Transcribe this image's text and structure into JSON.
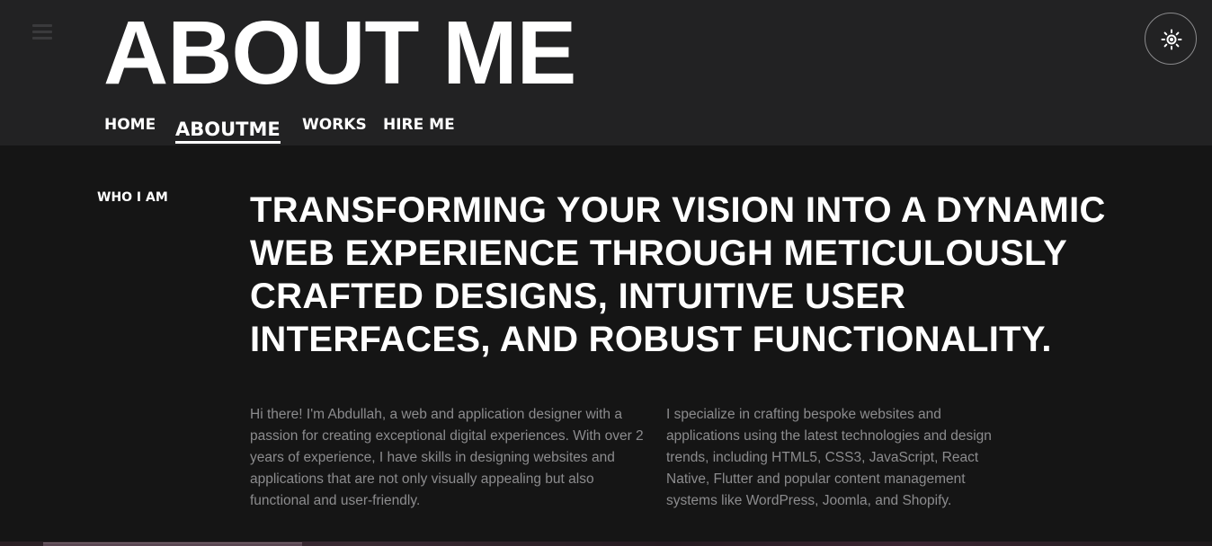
{
  "header": {
    "title": "ABOUT ME",
    "menu_icon": "hamburger-menu-icon",
    "theme_toggle_icon": "sun-icon"
  },
  "nav": {
    "items": [
      {
        "label": "HOME"
      },
      {
        "label": "ABOUTME",
        "active": true
      },
      {
        "label": "WORKS"
      },
      {
        "label": "HIRE ME"
      }
    ]
  },
  "about": {
    "section_label": "WHO I AM",
    "headline": "TRANSFORMING YOUR VISION INTO A DYNAMIC WEB EXPERIENCE THROUGH METICULOUSLY CRAFTED DESIGNS, INTUITIVE USER INTERFACES, AND ROBUST FUNCTIONALITY.",
    "paragraph_left": "Hi there! I'm Abdullah, a web and application designer with a passion for creating exceptional digital experiences. With over 2 years of experience, I have skills in designing websites and applications that are not only visually appealing but also functional and user-friendly.",
    "paragraph_right": "I specialize in crafting bespoke websites and applications using the latest technologies and design trends, including HTML5, CSS3, JavaScript, React Native, Flutter and popular content management systems like WordPress, Joomla, and Shopify."
  },
  "colors": {
    "header_bg": "#222223",
    "page_bg": "#151515",
    "text_primary": "#ffffff",
    "text_muted": "#8c8c8e"
  }
}
